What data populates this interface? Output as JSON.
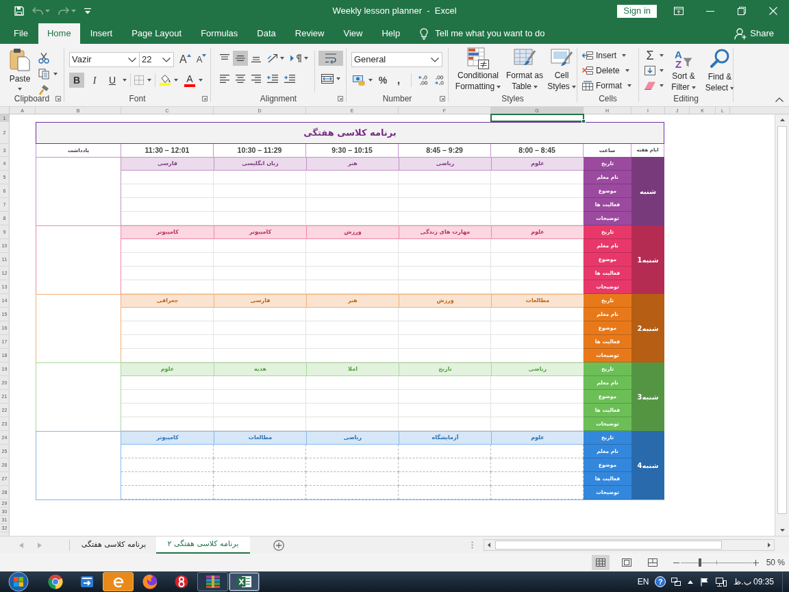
{
  "title_bar": {
    "quick_access": [
      {
        "kind": "customize",
        "disabled": false
      },
      {
        "kind": "redo",
        "disabled": true
      },
      {
        "kind": "undo",
        "disabled": true
      },
      {
        "kind": "save",
        "disabled": false
      }
    ],
    "title": "Weekly lesson planner  -  Excel",
    "sign_in": "Sign in"
  },
  "menu_tabs": [
    {
      "label": "Help",
      "selected": false
    },
    {
      "label": "View",
      "selected": false
    },
    {
      "label": "Review",
      "selected": false
    },
    {
      "label": "Data",
      "selected": false
    },
    {
      "label": "Formulas",
      "selected": false
    },
    {
      "label": "Page Layout",
      "selected": false
    },
    {
      "label": "Insert",
      "selected": false
    },
    {
      "label": "Home",
      "selected": true
    },
    {
      "label": "File",
      "selected": false
    }
  ],
  "tell_me": {
    "placeholder": "Tell me what you want to do"
  },
  "share": "Share",
  "ribbon": {
    "clipboard": {
      "label": "Clipboard",
      "paste": "Paste"
    },
    "font": {
      "label": "Font",
      "font_name": "Vazir",
      "font_size": "22",
      "size_buttons": [
        {
          "kind": "shrink",
          "glyph": "A"
        },
        {
          "kind": "grow",
          "glyph": "A"
        }
      ],
      "styles": [
        {
          "kind": "underline",
          "label": "U",
          "on": false
        },
        {
          "kind": "italic",
          "label": "I",
          "on": false
        },
        {
          "kind": "bold",
          "label": "B",
          "on": true
        }
      ],
      "color_buttons": [
        {
          "kind": "text",
          "glyph": "A",
          "color": "#ff0000"
        },
        {
          "kind": "fill",
          "color": "#ffff00"
        }
      ]
    },
    "alignment": {
      "label": "Alignment",
      "buttons": [
        {
          "kind": "top",
          "on": false
        },
        {
          "kind": "middle",
          "on": true
        },
        {
          "kind": "bottom",
          "on": false
        },
        {
          "kind": "orientation",
          "on": false
        },
        {
          "kind": "direction",
          "on": false
        },
        {
          "kind": "wrap",
          "on": true
        },
        {
          "kind": "left",
          "on": false
        },
        {
          "kind": "center",
          "on": false
        },
        {
          "kind": "right",
          "on": false
        },
        {
          "kind": "outdent",
          "on": false
        },
        {
          "kind": "indent",
          "on": false
        },
        {
          "kind": "merge",
          "on": false
        }
      ]
    },
    "number": {
      "label": "Number",
      "format": "General",
      "symbols": [
        ",",
        "%"
      ]
    },
    "styles": {
      "label": "Styles",
      "buttons": [
        {
          "kind": "cell_styles",
          "label": "Cell Styles"
        },
        {
          "kind": "table",
          "label": "Format as Table"
        },
        {
          "kind": "conditional",
          "label": "Conditional Formatting"
        }
      ]
    },
    "cells": {
      "label": "Cells",
      "buttons": [
        {
          "kind": "insert",
          "label": "Insert"
        },
        {
          "kind": "delete",
          "label": "Delete"
        },
        {
          "kind": "format",
          "label": "Format"
        }
      ]
    },
    "editing": {
      "label": "Editing",
      "small_buttons": [
        {
          "kind": "autosum",
          "glyph": "Σ"
        },
        {
          "kind": "fill"
        },
        {
          "kind": "clear"
        }
      ],
      "buttons": [
        {
          "kind": "find",
          "label": "Find & Select"
        },
        {
          "kind": "sort",
          "label": "Sort & Filter",
          "glyphs": [
            "A",
            "Z"
          ]
        }
      ]
    }
  },
  "sheet": {
    "columns": [
      {
        "label": "L",
        "selected": false
      },
      {
        "label": "K",
        "selected": false
      },
      {
        "label": "J",
        "selected": false
      },
      {
        "label": "I",
        "selected": false
      },
      {
        "label": "H",
        "selected": false
      },
      {
        "label": "G",
        "selected": true
      },
      {
        "label": "F",
        "selected": false
      },
      {
        "label": "E",
        "selected": false
      },
      {
        "label": "D",
        "selected": false
      },
      {
        "label": "C",
        "selected": false
      },
      {
        "label": "B",
        "selected": false
      },
      {
        "label": "A",
        "selected": false
      }
    ],
    "rows": [
      {
        "label": "1",
        "selected": true
      },
      {
        "label": "2",
        "selected": false
      },
      {
        "label": "3",
        "selected": false
      },
      {
        "label": "4",
        "selected": false
      },
      {
        "label": "5",
        "selected": false
      },
      {
        "label": "6",
        "selected": false
      },
      {
        "label": "7",
        "selected": false
      },
      {
        "label": "8",
        "selected": false
      },
      {
        "label": "9",
        "selected": false
      },
      {
        "label": "10",
        "selected": false
      },
      {
        "label": "11",
        "selected": false
      },
      {
        "label": "12",
        "selected": false
      },
      {
        "label": "13",
        "selected": false
      },
      {
        "label": "14",
        "selected": false
      },
      {
        "label": "15",
        "selected": false
      },
      {
        "label": "16",
        "selected": false
      },
      {
        "label": "17",
        "selected": false
      },
      {
        "label": "18",
        "selected": false
      },
      {
        "label": "19",
        "selected": false
      },
      {
        "label": "20",
        "selected": false
      },
      {
        "label": "21",
        "selected": false
      },
      {
        "label": "22",
        "selected": false
      },
      {
        "label": "23",
        "selected": false
      },
      {
        "label": "24",
        "selected": false
      },
      {
        "label": "25",
        "selected": false
      },
      {
        "label": "26",
        "selected": false
      },
      {
        "label": "27",
        "selected": false
      },
      {
        "label": "28",
        "selected": false
      },
      {
        "label": "29",
        "selected": false
      },
      {
        "label": "30",
        "selected": false
      },
      {
        "label": "31",
        "selected": false
      },
      {
        "label": "32",
        "selected": false
      }
    ],
    "planner": {
      "title": "برنامه کلاسی هفتگی",
      "notes_header": "یادداشت",
      "times": [
        "8:00 – 8:45",
        "8:45 – 9:29",
        "9:30 – 10:15",
        "10:30 – 11:29",
        "11:30 – 12:01"
      ],
      "hour_header": "ساعت",
      "day_header": "ایام هفته",
      "days": [
        {
          "name": "شنبه",
          "color": "#9b4a9f",
          "dashed": false,
          "subjects": [
            "علوم",
            "ریاضی",
            "هنر",
            "زبان انگلیسی",
            "فارسی"
          ],
          "row_labels": [
            "تاریخ",
            "نام معلم",
            "موضوع",
            "فعالیت ها",
            "توضیحات"
          ]
        },
        {
          "name": "1شنبه",
          "color": "#e8386a",
          "dashed": false,
          "subjects": [
            "علوم",
            "مهارت های زندگی",
            "ورزش",
            "کامپیوتر",
            "کامپیوتر"
          ],
          "row_labels": [
            "تاریخ",
            "نام معلم",
            "موضوع",
            "فعالیت ها",
            "توضیحات"
          ]
        },
        {
          "name": "2شنبه",
          "color": "#e8791a",
          "dashed": false,
          "subjects": [
            "مطالعات",
            "ورزش",
            "هنر",
            "فارسی",
            "جغرافی"
          ],
          "row_labels": [
            "تاریخ",
            "نام معلم",
            "موضوع",
            "فعالیت ها",
            "توضیحات"
          ]
        },
        {
          "name": "3شنبه",
          "color": "#6cbf56",
          "dashed": false,
          "subjects": [
            "ریاضی",
            "تاریخ",
            "املا",
            "هدیه",
            "علوم"
          ],
          "row_labels": [
            "تاریخ",
            "نام معلم",
            "موضوع",
            "فعالیت ها",
            "توضیحات"
          ]
        },
        {
          "name": "4شنبه",
          "color": "#3388dd",
          "dashed": true,
          "subjects": [
            "علوم",
            "آزمایشگاه",
            "ریاضی",
            "مطالعات",
            "کامپیوتر"
          ],
          "row_labels": [
            "تاریخ",
            "نام معلم",
            "موضوع",
            "فعالیت ها",
            "توضیحات"
          ]
        }
      ]
    }
  },
  "sheet_tabs": {
    "nav_buttons": [
      {
        "kind": "next",
        "disabled": true
      },
      {
        "kind": "prev",
        "disabled": true
      }
    ],
    "tabs": [
      {
        "label": "برنامه کلاسی هفتگی ۲",
        "selected": true
      },
      {
        "label": "برنامه کلاسی هفتگی",
        "selected": false
      }
    ]
  },
  "status_bar": {
    "views": [
      {
        "kind": "page_break",
        "selected": false
      },
      {
        "kind": "page_layout",
        "selected": false
      },
      {
        "kind": "normal",
        "selected": true
      }
    ],
    "zoom": {
      "level": 0.27,
      "reading": "50 %"
    }
  },
  "taskbar": {
    "apps": [
      {
        "kind": "sheet",
        "running": true,
        "selected": true,
        "flashing": false
      },
      {
        "kind": "books",
        "running": true,
        "selected": false,
        "flashing": false
      },
      {
        "kind": "badge",
        "running": false,
        "selected": false,
        "flashing": false
      },
      {
        "kind": "globe",
        "running": false,
        "selected": false,
        "flashing": false
      },
      {
        "kind": "swirl",
        "running": false,
        "selected": false,
        "flashing": true
      },
      {
        "kind": "transfer",
        "running": false,
        "selected": false,
        "flashing": false
      },
      {
        "kind": "ring",
        "running": false,
        "selected": false,
        "flashing": false
      }
    ],
    "tray": {
      "language": "EN",
      "help_glyph": "?",
      "time": "09:35 ب.ظ"
    }
  }
}
